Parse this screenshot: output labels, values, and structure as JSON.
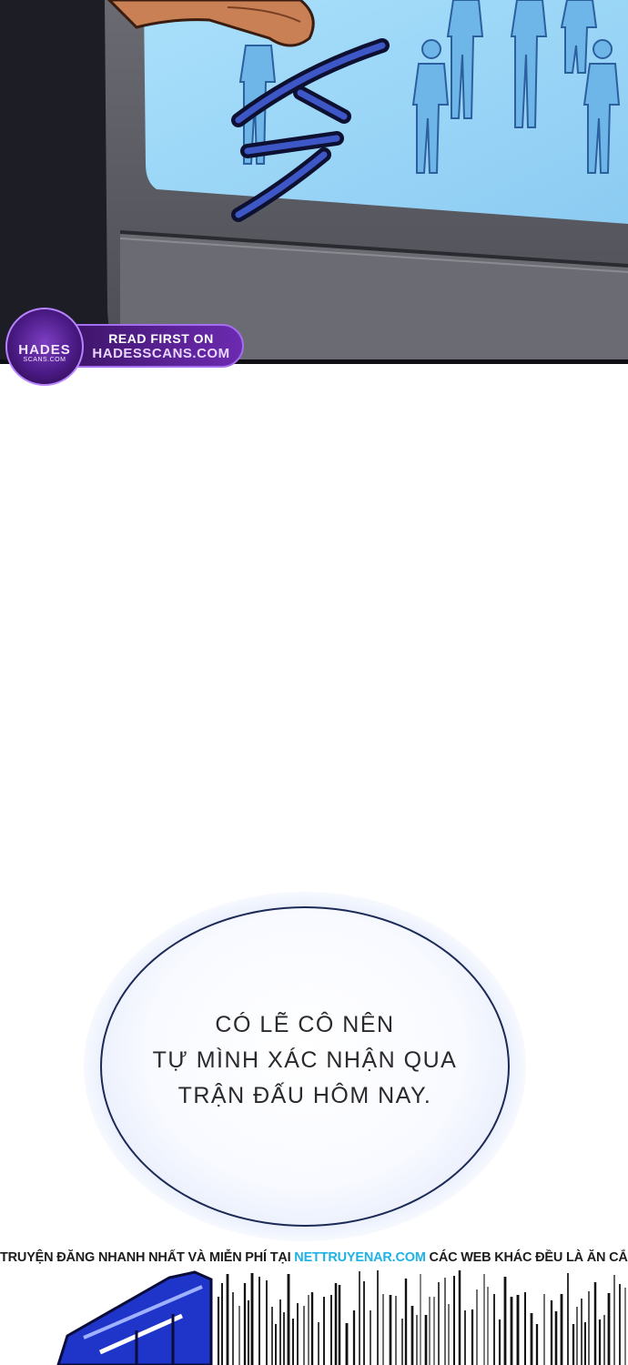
{
  "watermark": {
    "emblem_title": "HADES",
    "emblem_sub": "SCANS.COM",
    "line1": "READ FIRST ON",
    "line2": "HADESSCANS.COM"
  },
  "speech_bubble": {
    "lines": [
      "CÓ LẼ CÔ NÊN",
      "TỰ MÌNH XÁC NHẬN QUA",
      "TRẬN ĐẤU HÔM NAY."
    ]
  },
  "notice": {
    "before": "TRUYỆN ĐĂNG NHANH NHẤT VÀ MIỄN PHÍ TẠI ",
    "site": "NETTRUYENAR.COM",
    "after": " CÁC WEB KHÁC ĐỀU LÀ ĂN CẮP"
  },
  "colors": {
    "screen_blue": "#9ed7f7",
    "bezel_gray": "#5f6066",
    "badge_purple": "#5b2296",
    "notice_link": "#1eb2e6",
    "bubble_outline": "#1d2a55"
  }
}
